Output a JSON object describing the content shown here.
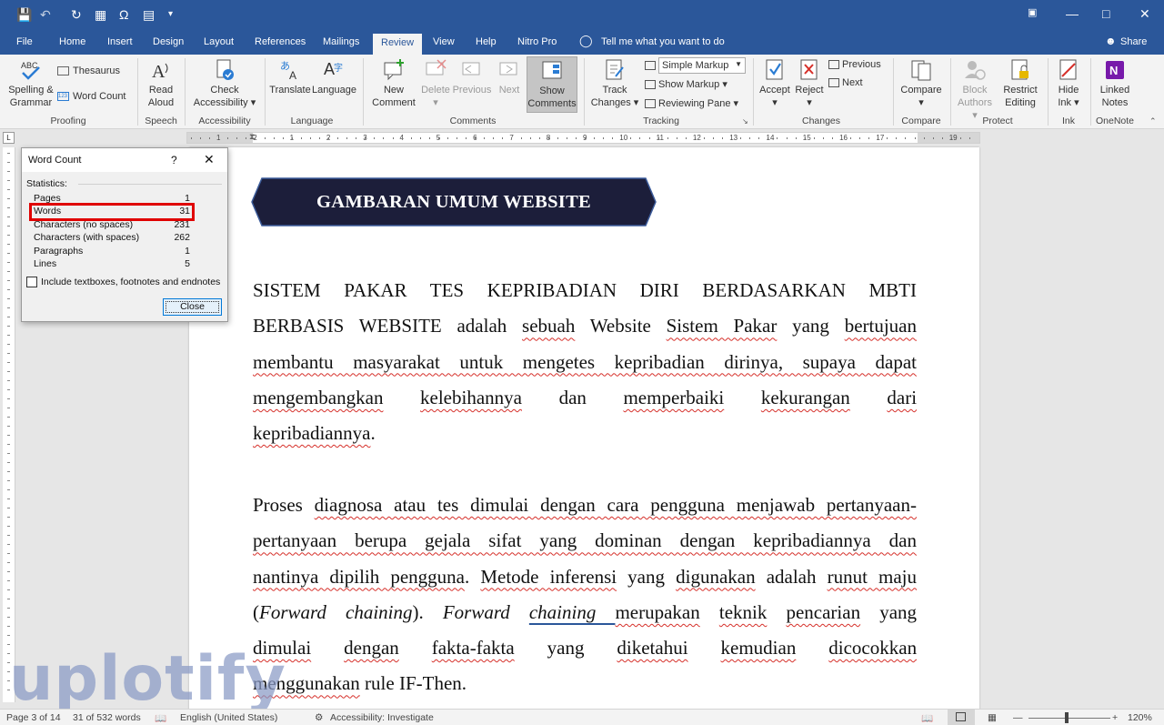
{
  "titlebar": {
    "qa_icons": [
      "save-icon",
      "undo-icon",
      "redo-icon",
      "table-icon",
      "omega-icon",
      "document-icon",
      "customize-icon"
    ],
    "window_icons": [
      "restore-ribbon-icon",
      "minimize-icon",
      "maximize-icon",
      "close-icon"
    ]
  },
  "tabs": [
    {
      "label": "File"
    },
    {
      "label": "Home"
    },
    {
      "label": "Insert"
    },
    {
      "label": "Design"
    },
    {
      "label": "Layout"
    },
    {
      "label": "References"
    },
    {
      "label": "Mailings"
    },
    {
      "label": "Review"
    },
    {
      "label": "View"
    },
    {
      "label": "Help"
    },
    {
      "label": "Nitro Pro"
    }
  ],
  "active_tab": "Review",
  "tell_me": "Tell me what you want to do",
  "share": "Share",
  "ribbon": {
    "spelling": "Spelling &",
    "spelling2": "Grammar",
    "abc": "ABC",
    "thesaurus": "Thesaurus",
    "word_count": "Word Count",
    "read": "Read",
    "aloud": "Aloud",
    "check": "Check",
    "accessibility": "Accessibility",
    "translate": "Translate",
    "language": "Language",
    "new": "New",
    "comment": "Comment",
    "delete": "Delete",
    "previous": "Previous",
    "next": "Next",
    "show": "Show",
    "comments": "Comments",
    "track": "Track",
    "changes": "Changes",
    "simple_markup": "Simple Markup",
    "show_markup": "Show Markup",
    "reviewing_pane": "Reviewing Pane",
    "accept": "Accept",
    "reject": "Reject",
    "prev_change": "Previous",
    "next_change": "Next",
    "compare": "Compare",
    "block": "Block",
    "authors": "Authors",
    "restrict": "Restrict",
    "editing": "Editing",
    "hide": "Hide",
    "ink": "Ink",
    "linked": "Linked",
    "notes": "Notes",
    "groups": {
      "proofing": "Proofing",
      "speech": "Speech",
      "accessibility": "Accessibility",
      "language": "Language",
      "comments": "Comments",
      "tracking": "Tracking",
      "changes": "Changes",
      "compare": "Compare",
      "protect": "Protect",
      "ink": "Ink",
      "onenote": "OneNote"
    }
  },
  "ruler_numbers": [
    "1",
    "2",
    "1",
    "2",
    "3",
    "4",
    "5",
    "6",
    "7",
    "8",
    "9",
    "10",
    "11",
    "12",
    "13",
    "14",
    "15",
    "16",
    "17",
    "19"
  ],
  "document": {
    "heading": "GAMBARAN UMUM WEBSITE",
    "p1": [
      "SISTEM PAKAR TES KEPRIBADIAN DIRI BERDASARKAN MBTI",
      "BERBASIS WEBSITE adalah sebuah Website Sistem Pakar yang bertujuan",
      "membantu masyarakat untuk mengetes kepribadian dirinya, supaya dapat",
      "mengembangkan kelebihannya dan memperbaiki kekurangan dari",
      "kepribadiannya."
    ],
    "p2": [
      "Proses diagnosa atau tes dimulai dengan cara pengguna menjawab pertanyaan-",
      "pertanyaan berupa gejala sifat yang dominan dengan kepribadiannya dan",
      "nantinya dipilih pengguna. Metode inferensi yang digunakan adalah runut maju",
      "(Forward chaining). Forward chaining merupakan teknik pencarian yang",
      "dimulai dengan fakta-fakta yang diketahui kemudian dicocokkan",
      "menggunakan rule IF-Then."
    ]
  },
  "dialog": {
    "title": "Word Count",
    "help": "?",
    "statistics": "Statistics:",
    "rows": [
      {
        "label": "Pages",
        "value": "1"
      },
      {
        "label": "Words",
        "value": "31"
      },
      {
        "label": "Characters (no spaces)",
        "value": "231"
      },
      {
        "label": "Characters (with spaces)",
        "value": "262"
      },
      {
        "label": "Paragraphs",
        "value": "1"
      },
      {
        "label": "Lines",
        "value": "5"
      }
    ],
    "include": "Include textboxes, footnotes and endnotes",
    "close": "Close"
  },
  "status": {
    "page": "Page 3 of 14",
    "words": "31 of 532 words",
    "language": "English (United States)",
    "accessibility": "Accessibility: Investigate",
    "zoom": "120%"
  },
  "watermark": "uplotify",
  "colors": {
    "brand": "#2b579a",
    "heading_bg": "#1c1e3a",
    "highlight": "#e00000"
  }
}
